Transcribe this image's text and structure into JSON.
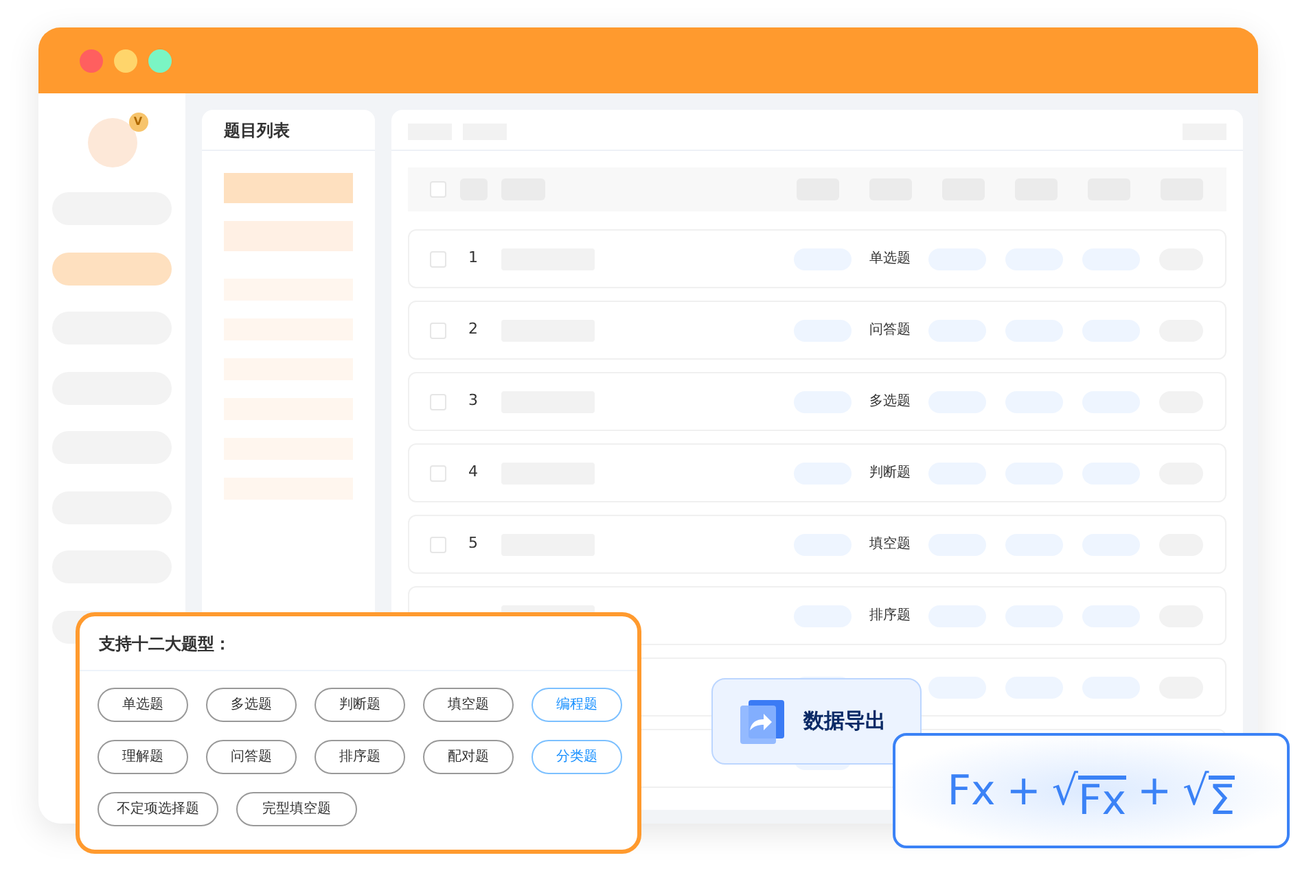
{
  "window": {
    "controls": [
      {
        "color": "#ff5f5f"
      },
      {
        "color": "#ffd56b"
      },
      {
        "color": "#7af5c4"
      }
    ]
  },
  "sidebar": {
    "badge": "V",
    "items": [
      {
        "selected": false
      },
      {
        "selected": true
      },
      {
        "selected": false
      },
      {
        "selected": false
      },
      {
        "selected": false
      },
      {
        "selected": false
      },
      {
        "selected": false
      },
      {
        "selected": false
      }
    ]
  },
  "question_list": {
    "title": "题目列表",
    "items": [
      {
        "selected": true
      },
      {
        "selected": false
      },
      {
        "selected": false
      },
      {
        "selected": false
      },
      {
        "selected": false
      },
      {
        "selected": false
      },
      {
        "selected": false
      },
      {
        "selected": false
      }
    ]
  },
  "table": {
    "header_checked": false,
    "rows": [
      {
        "number": "1",
        "type": "单选题",
        "checked": false
      },
      {
        "number": "2",
        "type": "问答题",
        "checked": false
      },
      {
        "number": "3",
        "type": "多选题",
        "checked": false
      },
      {
        "number": "4",
        "type": "判断题",
        "checked": false
      },
      {
        "number": "5",
        "type": "填空题",
        "checked": false
      },
      {
        "type": "排序题"
      },
      {},
      {}
    ]
  },
  "types_card": {
    "title": "支持十二大题型：",
    "tags": [
      {
        "label": "单选题",
        "highlighted": false
      },
      {
        "label": "多选题",
        "highlighted": false
      },
      {
        "label": "判断题",
        "highlighted": false
      },
      {
        "label": "填空题",
        "highlighted": false
      },
      {
        "label": "编程题",
        "highlighted": true
      },
      {
        "label": "理解题",
        "highlighted": false
      },
      {
        "label": "问答题",
        "highlighted": false
      },
      {
        "label": "排序题",
        "highlighted": false
      },
      {
        "label": "配对题",
        "highlighted": false
      },
      {
        "label": "分类题",
        "highlighted": true
      },
      {
        "label": "不定项选择题",
        "highlighted": false
      },
      {
        "label": "完型填空题",
        "highlighted": false
      }
    ]
  },
  "export_button": {
    "label": "数据导出"
  },
  "formula": {
    "terms": [
      {
        "kind": "plain",
        "text": "Fx"
      },
      {
        "kind": "op",
        "text": "+"
      },
      {
        "kind": "root",
        "sign": "√",
        "text": "Fx"
      },
      {
        "kind": "op",
        "text": "+"
      },
      {
        "kind": "root",
        "sign": "√",
        "text": "Σ"
      }
    ]
  }
}
